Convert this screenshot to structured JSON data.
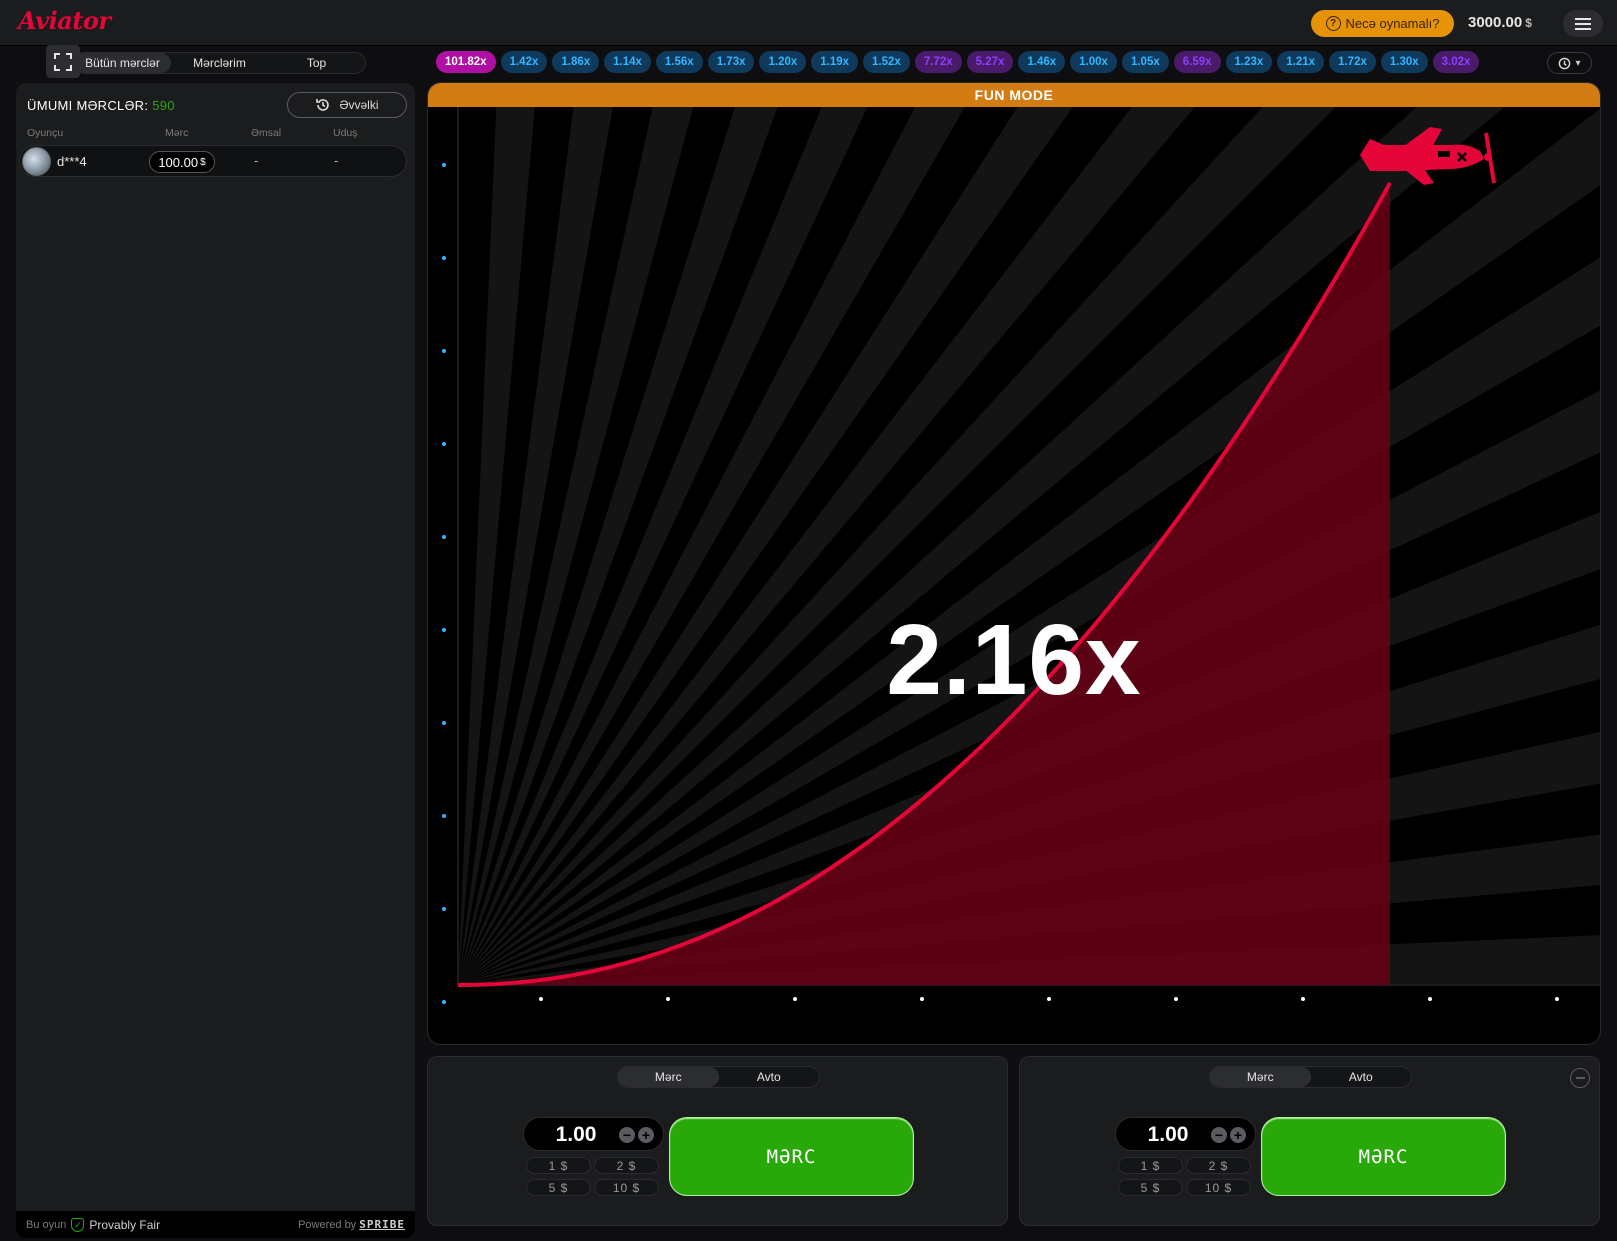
{
  "header": {
    "logo": "Aviator",
    "how_to_play": "Necə oynamalı?",
    "balance": "3000.00",
    "currency": "$"
  },
  "bets_tabs": [
    "Bütün mərclər",
    "Mərclərim",
    "Top"
  ],
  "history": [
    {
      "v": "101.82x",
      "kind": "pink"
    },
    {
      "v": "1.42x",
      "kind": "blue"
    },
    {
      "v": "1.86x",
      "kind": "blue"
    },
    {
      "v": "1.14x",
      "kind": "blue"
    },
    {
      "v": "1.56x",
      "kind": "blue"
    },
    {
      "v": "1.73x",
      "kind": "blue"
    },
    {
      "v": "1.20x",
      "kind": "blue"
    },
    {
      "v": "1.19x",
      "kind": "blue"
    },
    {
      "v": "1.52x",
      "kind": "blue"
    },
    {
      "v": "7.72x",
      "kind": "purple"
    },
    {
      "v": "5.27x",
      "kind": "purple"
    },
    {
      "v": "1.46x",
      "kind": "blue"
    },
    {
      "v": "1.00x",
      "kind": "blue"
    },
    {
      "v": "1.05x",
      "kind": "blue"
    },
    {
      "v": "6.59x",
      "kind": "purple"
    },
    {
      "v": "1.23x",
      "kind": "blue"
    },
    {
      "v": "1.21x",
      "kind": "blue"
    },
    {
      "v": "1.72x",
      "kind": "blue"
    },
    {
      "v": "1.30x",
      "kind": "blue"
    },
    {
      "v": "3.02x",
      "kind": "purple"
    }
  ],
  "left": {
    "total_label": "ÜMUMI MƏRCLƏR:",
    "total_count": "590",
    "previous_button": "Əvvəlki",
    "columns": [
      "Oyunçu",
      "Mərc",
      "Əmsal",
      "Uduş"
    ],
    "players": [
      {
        "name": "d***4",
        "bet": "100.00",
        "currency": "$",
        "coef": "-",
        "win": "-"
      }
    ],
    "footer": {
      "this_game": "Bu oyun",
      "provably_fair": "Provably Fair",
      "powered_by": "Powered by",
      "brand": "SPRIBE"
    }
  },
  "game": {
    "banner": "FUN MODE",
    "multiplier": "2.16x",
    "colors": {
      "curve": "#e50539",
      "fill": "#6b0016",
      "banner": "#d27c13"
    }
  },
  "bet_panels": [
    {
      "tabs": [
        "Mərc",
        "Avto"
      ],
      "amount": "1.00",
      "minus": "−",
      "plus": "+",
      "quick": [
        "1 $",
        "2 $",
        "5 $",
        "10 $"
      ],
      "button": "MƏRC"
    },
    {
      "tabs": [
        "Mərc",
        "Avto"
      ],
      "amount": "1.00",
      "minus": "−",
      "plus": "+",
      "quick": [
        "1 $",
        "2 $",
        "5 $",
        "10 $"
      ],
      "button": "MƏRC"
    }
  ]
}
